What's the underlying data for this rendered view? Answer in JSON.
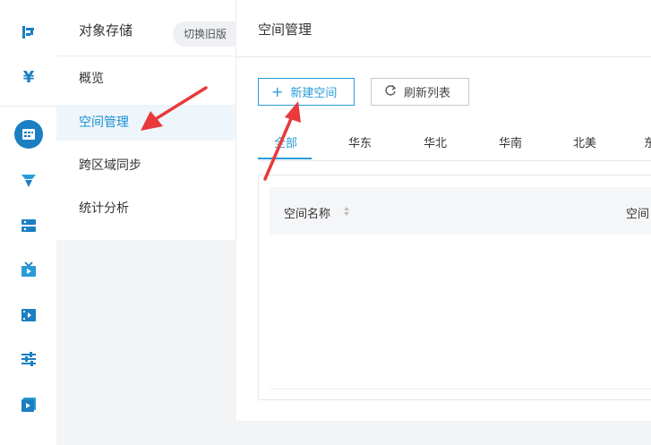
{
  "subnav": {
    "title": "对象存储",
    "switch_label": "切换旧版",
    "items": [
      {
        "label": "概览"
      },
      {
        "label": "空间管理"
      },
      {
        "label": "跨区域同步"
      },
      {
        "label": "统计分析"
      }
    ]
  },
  "main": {
    "title": "空间管理",
    "new_button": "新建空间",
    "refresh_button": "刷新列表",
    "tabs": [
      {
        "label": "全部"
      },
      {
        "label": "华东"
      },
      {
        "label": "华北"
      },
      {
        "label": "华南"
      },
      {
        "label": "北美"
      },
      {
        "label": "东"
      }
    ],
    "table": {
      "col1": "空间名称",
      "col2": "空间"
    }
  },
  "colors": {
    "accent": "#2a9bd8",
    "annotation": "#e8393b",
    "active_bg": "#eef6fb"
  },
  "rail_icons": [
    "qiniu-logo-icon",
    "billing-yen-icon",
    "storage-icon",
    "cdn-icon",
    "server-icon",
    "live-icon",
    "video-icon",
    "settings-sliders-icon",
    "media-icon"
  ]
}
